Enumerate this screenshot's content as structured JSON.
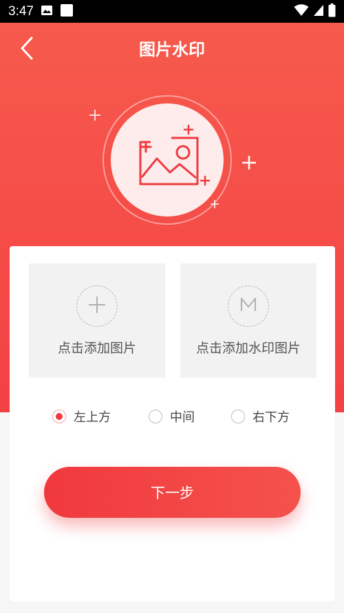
{
  "status_bar": {
    "time": "3:47",
    "icons": [
      "image-icon",
      "square-notification-icon",
      "wifi-icon",
      "cellular-signal-icon",
      "battery-icon"
    ]
  },
  "header": {
    "title": "图片水印",
    "back_icon": "chevron-left-icon"
  },
  "hero": {
    "illustration_icon": "image-placeholder-icon"
  },
  "upload": {
    "image_tile_label": "点击添加图片",
    "image_tile_icon": "plus-icon",
    "watermark_tile_label": "点击添加水印图片",
    "watermark_tile_icon": "m-letter-icon"
  },
  "position_options": [
    {
      "label": "左上方",
      "selected": true
    },
    {
      "label": "中间",
      "selected": false
    },
    {
      "label": "右下方",
      "selected": false
    }
  ],
  "actions": {
    "next_label": "下一步"
  },
  "colors": {
    "accent": "#f0393e",
    "hero_top": "#f65a4c",
    "hero_bottom": "#f44144",
    "tile_bg": "#f2f2f2"
  }
}
